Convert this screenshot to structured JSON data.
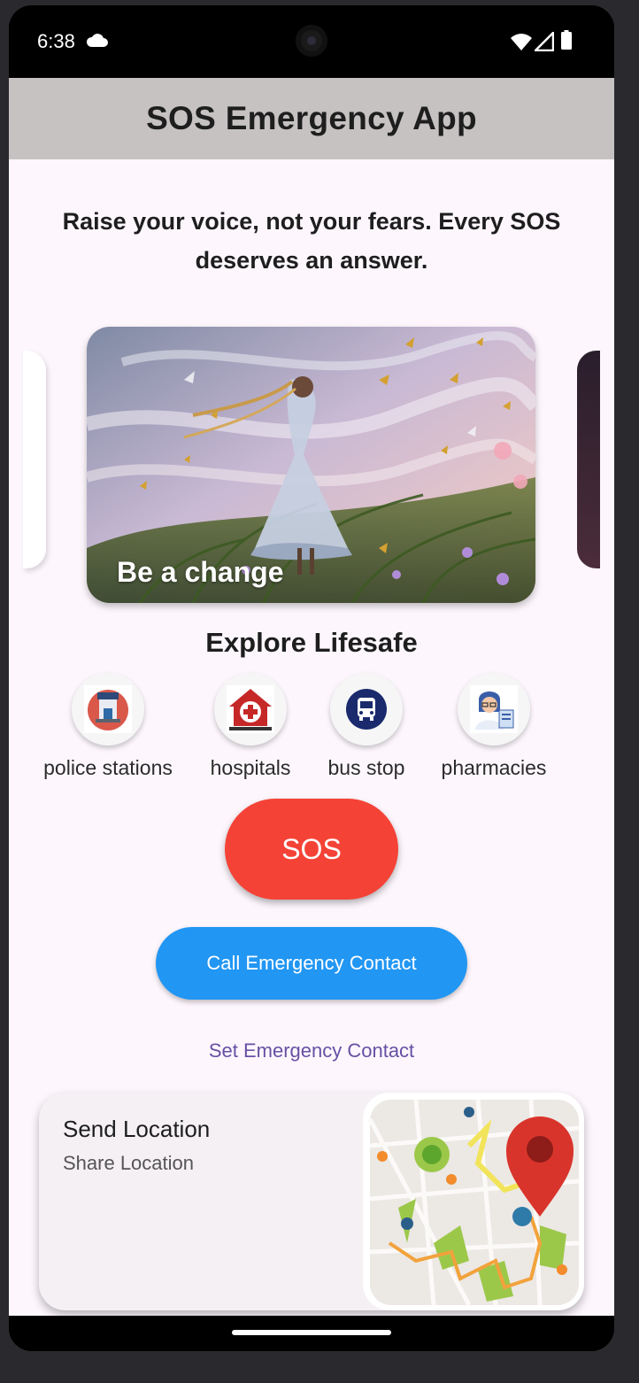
{
  "status_bar": {
    "time": "6:38",
    "icons": [
      "cloud-icon",
      "wifi-icon",
      "signal-icon",
      "battery-icon"
    ]
  },
  "app_bar": {
    "title": "SOS Emergency App"
  },
  "tagline": "Raise your voice, not your fears. Every SOS deserves an answer.",
  "carousel": {
    "caption": "Be a change"
  },
  "explore": {
    "title": "Explore Lifesafe",
    "categories": [
      {
        "label": "police stations",
        "icon": "police-station-icon"
      },
      {
        "label": "hospitals",
        "icon": "hospital-icon"
      },
      {
        "label": "bus stop",
        "icon": "bus-icon"
      },
      {
        "label": "pharmacies",
        "icon": "pharmacist-icon"
      }
    ]
  },
  "actions": {
    "sos_label": "SOS",
    "call_label": "Call Emergency Contact",
    "set_contact_label": "Set Emergency Contact"
  },
  "location_card": {
    "title": "Send Location",
    "subtitle": "Share Location",
    "icon": "map-pin-icon"
  },
  "colors": {
    "app_bar": "#c6c2c2",
    "background": "#fdf7fd",
    "sos": "#f44336",
    "call": "#2196f3",
    "link": "#6750a4"
  }
}
